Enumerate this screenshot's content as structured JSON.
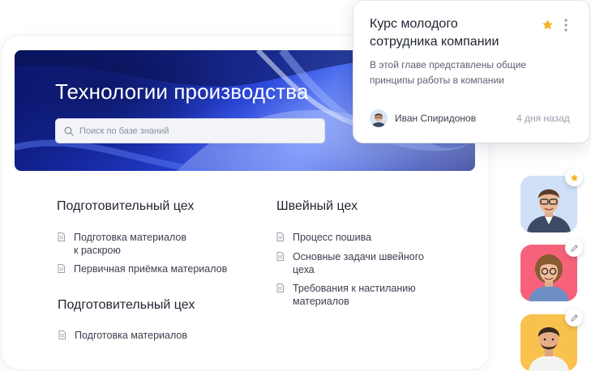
{
  "hero": {
    "title": "Технологии производства",
    "search_placeholder": "Поиск по базе знаний"
  },
  "sections": [
    {
      "title": "Подготовительный цех",
      "items": [
        {
          "lines": [
            "Подготовка материалов",
            "к раскрою"
          ]
        },
        {
          "lines": [
            "Первичная приёмка материалов"
          ]
        }
      ]
    },
    {
      "title": "Швейный цех",
      "items": [
        {
          "lines": [
            "Процесс пошива"
          ]
        },
        {
          "lines": [
            "Основные задачи швейного",
            "цеха"
          ]
        },
        {
          "lines": [
            "Требования к настиланию",
            "материалов"
          ]
        }
      ]
    },
    {
      "title": "Подготовительный цех",
      "items": [
        {
          "lines": [
            "Подготовка материалов"
          ]
        }
      ]
    }
  ],
  "course_card": {
    "title_lines": [
      "Курс молодого",
      "сотрудника компании"
    ],
    "description_lines": [
      "В этой главе представлены общие",
      "принципы работы в компании"
    ],
    "author": "Иван Спиридонов",
    "time": "4 дня назад",
    "favorite": true
  },
  "avatars": [
    {
      "icon": "star-icon",
      "bg": "#cfe0f6"
    },
    {
      "icon": "pencil-icon",
      "bg": "#f7627a"
    },
    {
      "icon": "pencil-icon",
      "bg": "#f9c24e"
    }
  ],
  "colors": {
    "accent_star": "#f6b42c",
    "hero_deep_blue": "#0a1670",
    "hero_bright_blue": "#4a6cf0"
  }
}
